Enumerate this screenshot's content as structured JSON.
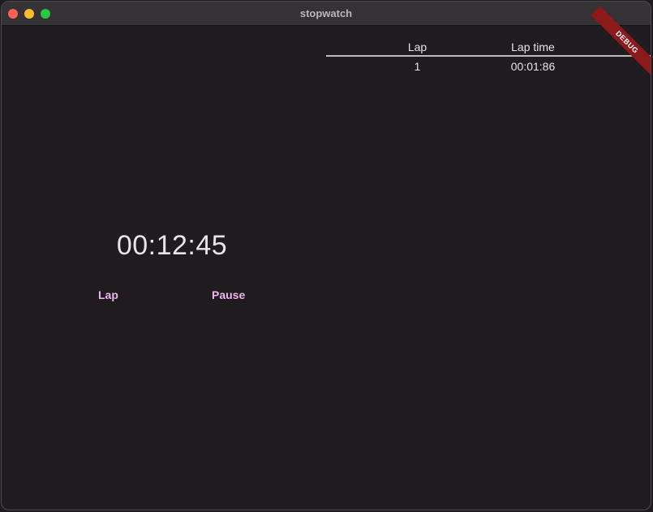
{
  "window": {
    "title": "stopwatch"
  },
  "stopwatch": {
    "time": "00:12:45",
    "lap_label": "Lap",
    "pause_label": "Pause"
  },
  "laps": {
    "headers": [
      "Lap",
      "Lap time"
    ],
    "rows": [
      {
        "lap": "1",
        "time": "00:01:86"
      }
    ]
  },
  "debug_banner": "DEBUG",
  "colors": {
    "background": "#1f1b1f",
    "accent": "#efb4ef",
    "banner": "#8c1a1a"
  }
}
